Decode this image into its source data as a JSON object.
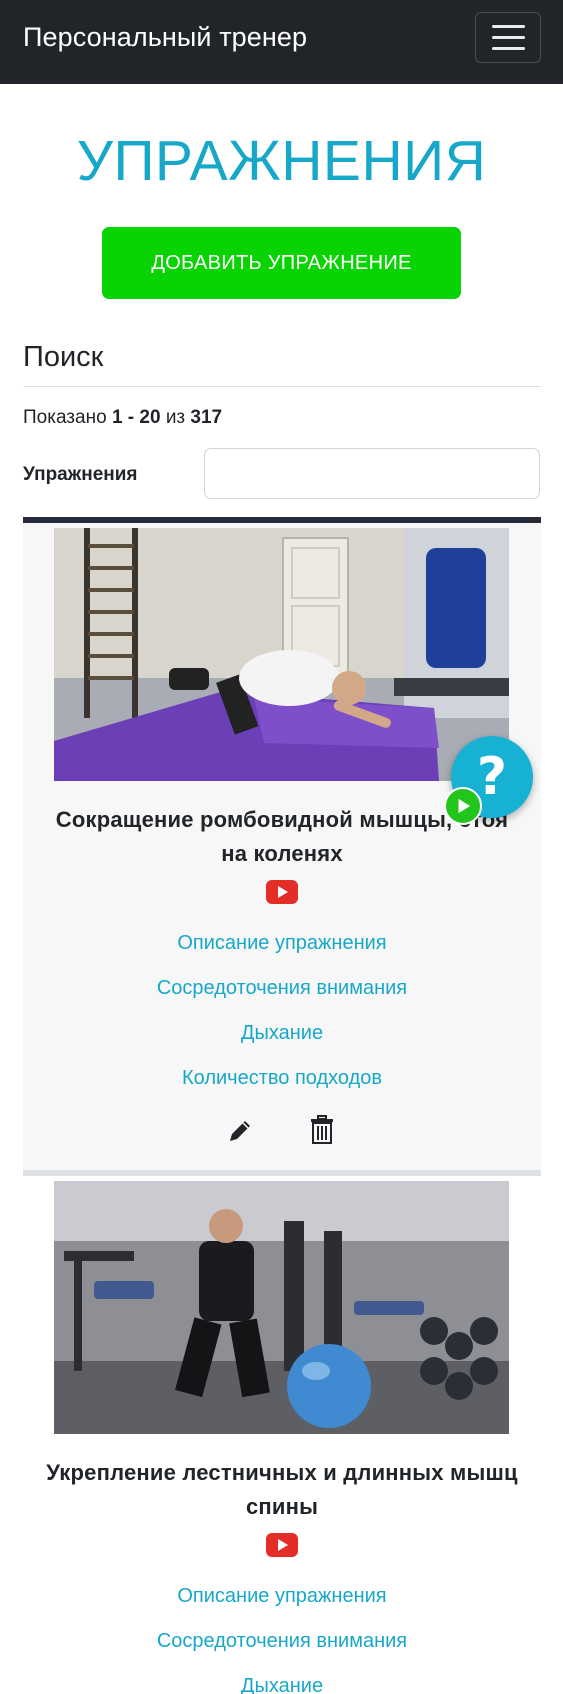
{
  "navbar": {
    "brand": "Персональный тренер",
    "toggle_icon": "hamburger-menu-icon"
  },
  "page": {
    "title": "УПРАЖНЕНИЯ",
    "add_button": "ДОБАВИТЬ УПРАЖНЕНИЕ"
  },
  "search": {
    "heading": "Поиск",
    "shown_prefix": "Показано",
    "shown_range": "1 - 20",
    "shown_of": "из",
    "shown_total": "317",
    "filter_label": "Упражнения",
    "filter_value": ""
  },
  "exercises": [
    {
      "title": "Сокращение ромбовидной мышцы, стоя на коленях",
      "links": [
        "Описание упражнения",
        "Сосредоточения внимания",
        "Дыхание",
        "Количество подходов"
      ]
    },
    {
      "title": "Укрепление лестничных и длинных мышц спины",
      "links": [
        "Описание упражнения",
        "Сосредоточения внимания",
        "Дыхание"
      ]
    }
  ],
  "help": {
    "symbol": "?"
  },
  "colors": {
    "navbar": "#212529",
    "accent": "#17a8c9",
    "add_button": "#0ad304",
    "youtube": "#e52d27"
  }
}
